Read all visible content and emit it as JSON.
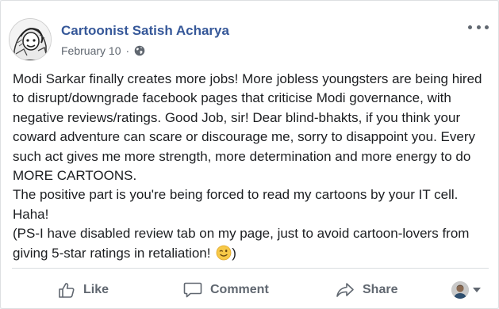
{
  "post": {
    "author": "Cartoonist Satish Acharya",
    "date": "February 10",
    "separator": "·",
    "privacy_icon": "globe-icon",
    "body_paragraphs": [
      "Modi Sarkar finally creates more jobs! More jobless youngsters are being hired to disrupt/downgrade facebook pages that criticise Modi governance, with negative reviews/ratings. Good Job, sir! Dear blind-bhakts, if you think your coward adventure can scare or discourage me, sorry to disappoint you. Every such act gives me more strength, more determination and more energy to do MORE CARTOONS.",
      "The positive part is you're being forced to read my cartoons by your IT cell. Haha!",
      "(PS-I have disabled review tab on my page, just to avoid cartoon-lovers from giving 5-star ratings in retaliation!"
    ],
    "body_end": ")",
    "emoji": "winking-face-icon"
  },
  "actions": {
    "like_label": "Like",
    "comment_label": "Comment",
    "share_label": "Share"
  },
  "colors": {
    "author_link": "#365899",
    "secondary_text": "#606770",
    "divider": "#dadde1"
  }
}
